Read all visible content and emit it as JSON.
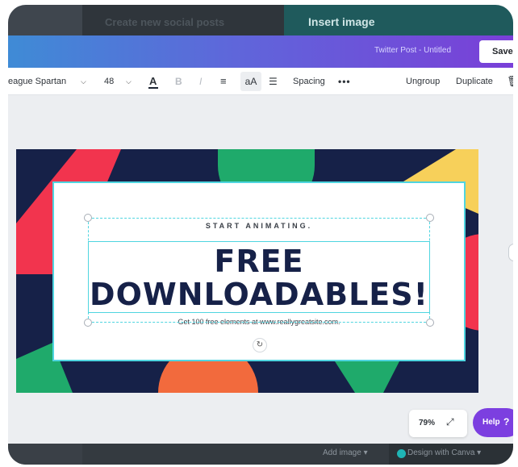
{
  "top_strip": {
    "left_label": "Create new social posts",
    "right_label": "Insert image"
  },
  "header": {
    "doc_title": "Twitter Post - Untitled",
    "save_label": "Save"
  },
  "toolbar": {
    "font_family": "eague Spartan",
    "font_size": "48",
    "color_glyph": "A",
    "bold_glyph": "B",
    "italic_glyph": "I",
    "align_glyph": "≡",
    "case_glyph": "aA",
    "list_glyph": "☰",
    "spacing_label": "Spacing",
    "more_glyph": "•••",
    "ungroup_label": "Ungroup",
    "duplicate_label": "Duplicate",
    "trash_glyph": "🗑"
  },
  "design": {
    "subtitle": "START ANIMATING.",
    "headline_line1": "FREE",
    "headline_line2": "DOWNLOADABLES!",
    "footline": "Get 100 free elements at www.reallygreatsite.com.",
    "colors": {
      "background": "#162148",
      "red": "#f2344e",
      "green": "#1faa6b",
      "yellow": "#f7d05a",
      "orange": "#f26a3d",
      "frame_border": "#4fd5e0"
    }
  },
  "zoom": {
    "value": "79%",
    "icon": "expand-icon"
  },
  "help": {
    "label": "Help",
    "glyph": "?"
  },
  "bottom_strip": {
    "add_image_label": "Add image ▾",
    "design_with_label": "Design with Canva ▾"
  }
}
